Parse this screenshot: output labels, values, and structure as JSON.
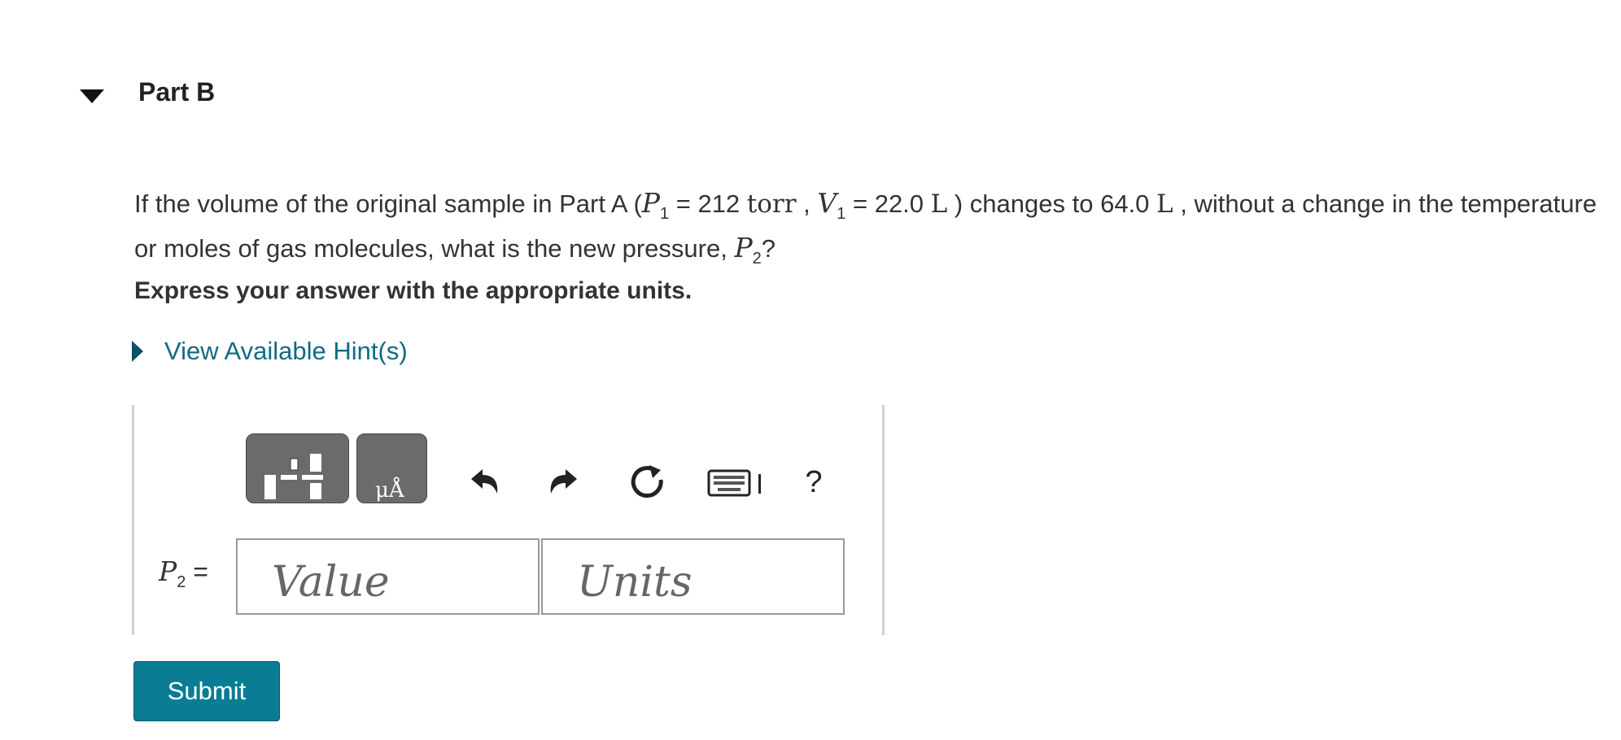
{
  "part": {
    "title": "Part B"
  },
  "question": {
    "text_start": "If the volume of the original sample in Part A (",
    "p1_symbol": "P",
    "p1_subscript": "1",
    "p1_eq": " = 212 ",
    "p1_unit": "torr",
    "sep": " , ",
    "v1_symbol": "V",
    "v1_subscript": "1",
    "v1_eq": " = 22.0 ",
    "v1_unit": "L",
    "text_mid": " ) changes to 64.0 ",
    "v2_unit": "L",
    "text_end": " , without a change in the temperature or moles of gas molecules, what is the new pressure, ",
    "p2_symbol": "P",
    "p2_subscript": "2",
    "text_q": "?"
  },
  "instruction": "Express your answer with the appropriate units.",
  "hints": {
    "label": "View Available Hint(s)"
  },
  "answer": {
    "label_symbol": "P",
    "label_subscript": "2",
    "label_eq": " =",
    "value_placeholder": "Value",
    "units_placeholder": "Units"
  },
  "toolbar": {
    "units_button_text": "μÅ",
    "help_label": "?"
  },
  "submit": {
    "label": "Submit"
  }
}
